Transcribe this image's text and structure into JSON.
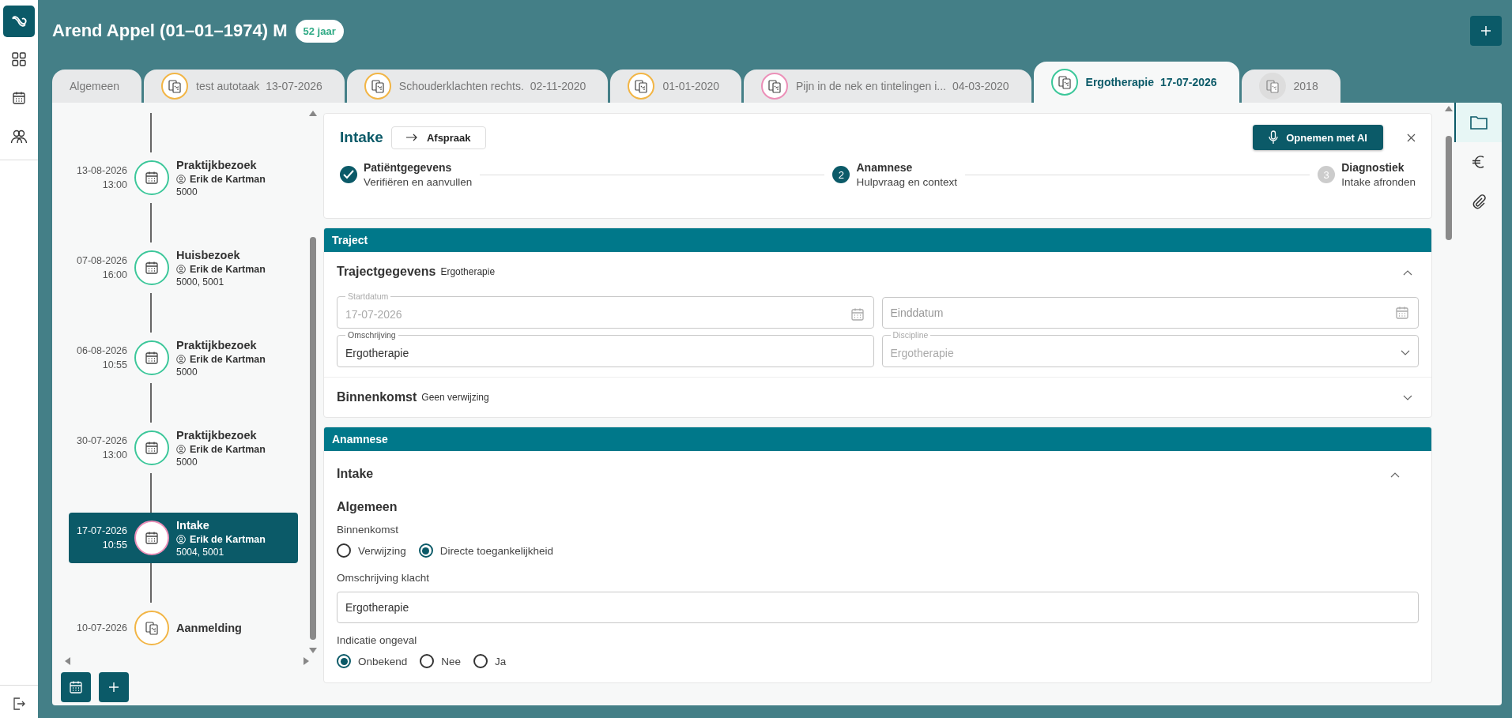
{
  "patient": {
    "name": "Arend Appel (01–01–1974) M",
    "age": "52 jaar"
  },
  "tabs": [
    {
      "kind": "plain",
      "label": "Algemeen",
      "selected": false
    },
    {
      "kind": "traject",
      "label": "test autotaak",
      "date": "13-07-2026",
      "color": "#f2b545",
      "selected": false
    },
    {
      "kind": "traject",
      "label": "Schouderklachten rechts.",
      "date": "02-11-2020",
      "color": "#f2b545",
      "selected": false
    },
    {
      "kind": "traject",
      "label": "01-01-2020",
      "color": "#f2b545",
      "selected": false
    },
    {
      "kind": "traject",
      "label": "Pijn in de nek en tintelingen i...",
      "date": "04-03-2020",
      "color": "#ec8fb8",
      "selected": false
    },
    {
      "kind": "traject",
      "label": "Ergotherapie",
      "date": "17-07-2026",
      "color": "#3cc79a",
      "selected": true
    },
    {
      "kind": "archived",
      "label": "2018",
      "selected": false
    }
  ],
  "timeline": [
    {
      "kind": "appointment",
      "date": "13-08-2026",
      "time": "13:00",
      "title": "Praktijkbezoek",
      "therapist": "Erik de Kartman",
      "codes": "5000",
      "color": "#3cc79a",
      "selected": false
    },
    {
      "kind": "appointment",
      "date": "07-08-2026",
      "time": "16:00",
      "title": "Huisbezoek",
      "therapist": "Erik de Kartman",
      "codes": "5000, 5001",
      "color": "#3cc79a",
      "selected": false
    },
    {
      "kind": "appointment",
      "date": "06-08-2026",
      "time": "10:55",
      "title": "Praktijkbezoek",
      "therapist": "Erik de Kartman",
      "codes": "5000",
      "color": "#3cc79a",
      "selected": false
    },
    {
      "kind": "appointment",
      "date": "30-07-2026",
      "time": "13:00",
      "title": "Praktijkbezoek",
      "therapist": "Erik de Kartman",
      "codes": "5000",
      "color": "#3cc79a",
      "selected": false
    },
    {
      "kind": "appointment",
      "date": "17-07-2026",
      "time": "10:55",
      "title": "Intake",
      "therapist": "Erik de Kartman",
      "codes": "5004, 5001",
      "color": "#ec8fb8",
      "selected": true
    },
    {
      "kind": "registration",
      "date": "10-07-2026",
      "title": "Aanmelding",
      "color": "#f2b545",
      "selected": false
    }
  ],
  "intake": {
    "title": "Intake",
    "link": "Afspraak",
    "record_button": "Opnemen met AI",
    "steps": [
      {
        "completed": true,
        "title": "Patiëntgegevens",
        "subtitle": "Verifiëren en aanvullen"
      },
      {
        "completed": false,
        "current": true,
        "number": "2",
        "title": "Anamnese",
        "subtitle": "Hulpvraag en context"
      },
      {
        "completed": false,
        "current": false,
        "number": "3",
        "title": "Diagnostiek",
        "subtitle": "Intake afronden"
      }
    ]
  },
  "traject": {
    "header": "Traject",
    "details": {
      "title": "Trajectgegevens",
      "subtitle": "Ergotherapie",
      "expanded": true,
      "fields": [
        {
          "kind": "date",
          "label": "Startdatum",
          "value": "17-07-2026",
          "disabled": true
        },
        {
          "kind": "date",
          "placeholder": "Einddatum",
          "disabled": false
        },
        {
          "kind": "text",
          "label": "Omschrijving",
          "value": "Ergotherapie",
          "disabled": false
        },
        {
          "kind": "select",
          "label": "Discipline",
          "value": "Ergotherapie",
          "disabled": true
        }
      ]
    },
    "referral": {
      "title": "Binnenkomst",
      "subtitle": "Geen verwijzing",
      "expanded": false
    }
  },
  "anamnese": {
    "header": "Anamnese",
    "section": {
      "title": "Intake",
      "expanded": true
    },
    "group": "Algemeen",
    "questions": [
      {
        "kind": "radio",
        "label": "Binnenkomst",
        "options": [
          {
            "label": "Verwijzing",
            "selected": false
          },
          {
            "label": "Directe toegankelijkheid",
            "selected": true
          }
        ]
      },
      {
        "kind": "text",
        "label": "Omschrijving klacht",
        "value": "Ergotherapie"
      },
      {
        "kind": "radio",
        "label": "Indicatie ongeval",
        "options": [
          {
            "label": "Onbekend",
            "selected": true
          },
          {
            "label": "Nee",
            "selected": false
          },
          {
            "label": "Ja",
            "selected": false
          }
        ]
      }
    ]
  },
  "side_tools": [
    {
      "kind": "folder",
      "selected": true
    },
    {
      "kind": "euro",
      "selected": false
    },
    {
      "kind": "attachment",
      "selected": false
    }
  ]
}
